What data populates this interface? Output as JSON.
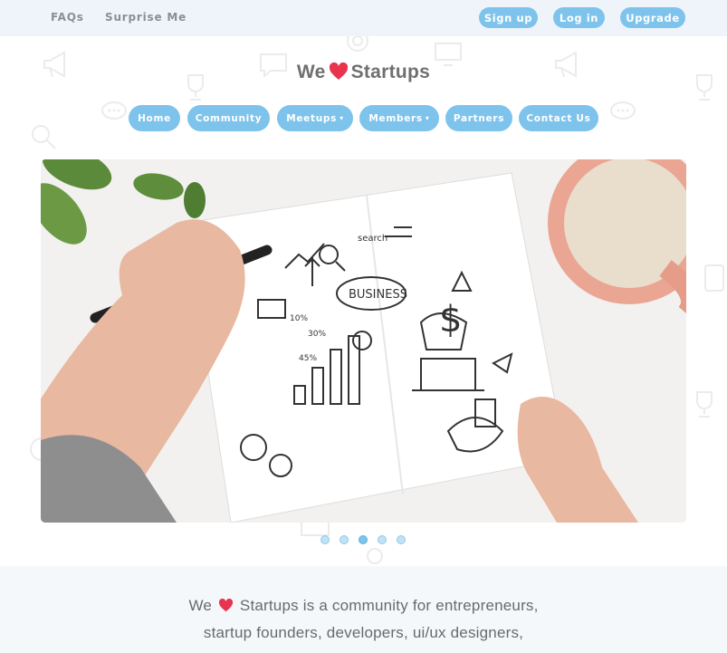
{
  "topbar": {
    "faqs": "FAQs",
    "surprise": "Surprise Me",
    "signup": "Sign up",
    "login": "Log in",
    "upgrade": "Upgrade"
  },
  "brand": {
    "before": "We",
    "after": "Startups"
  },
  "nav": [
    {
      "label": "Home"
    },
    {
      "label": "Community"
    },
    {
      "label": "Meetups"
    },
    {
      "label": "Members"
    },
    {
      "label": "Partners"
    },
    {
      "label": "Contact Us"
    }
  ],
  "slider": {
    "active_index": 2,
    "count": 5,
    "image_texts": {
      "business": "BUSINESS",
      "search": "search",
      "pct1": "10%",
      "pct2": "30%",
      "pct3": "45%"
    }
  },
  "about": {
    "line1_before": "We",
    "line1_after": "Startups is a community for entrepreneurs,",
    "line2": "startup founders, developers, ui/ux designers,"
  },
  "colors": {
    "accent": "#7ec3ec",
    "heart": "#e8344e",
    "topbar_bg": "#eef4fa"
  }
}
